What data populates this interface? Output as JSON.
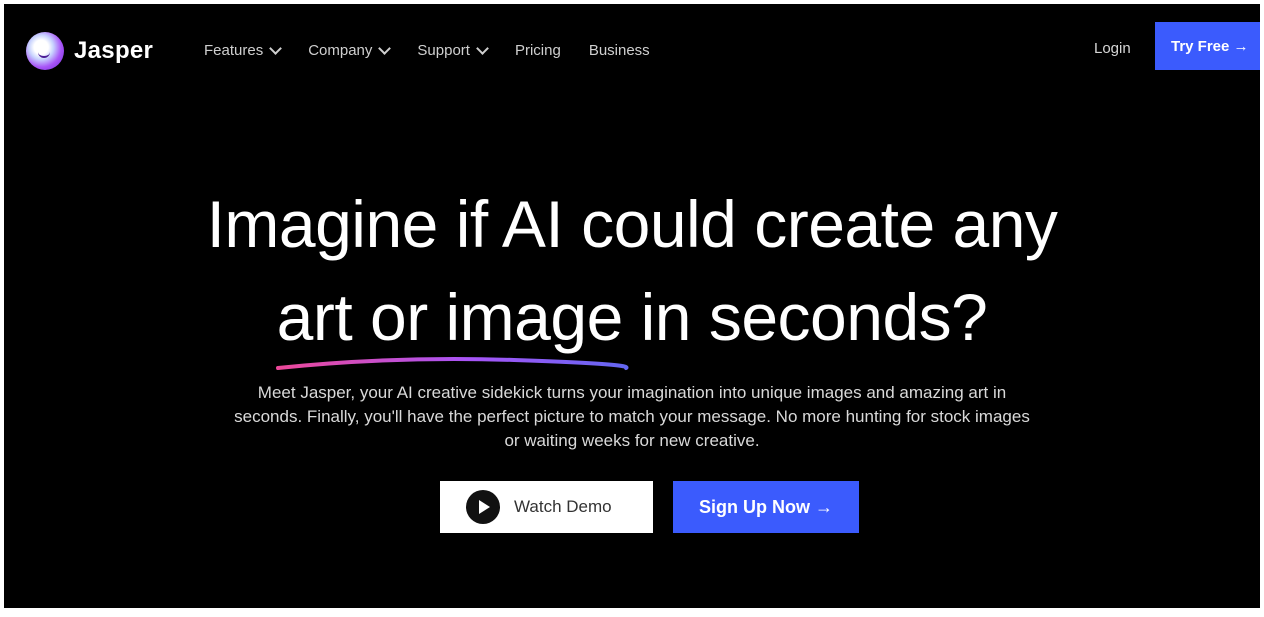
{
  "nav": {
    "logo_text": "Jasper",
    "items": [
      {
        "label": "Features",
        "has_dropdown": true
      },
      {
        "label": "Company",
        "has_dropdown": true
      },
      {
        "label": "Support",
        "has_dropdown": true
      },
      {
        "label": "Pricing",
        "has_dropdown": false
      },
      {
        "label": "Business",
        "has_dropdown": false
      }
    ],
    "login_label": "Login",
    "try_free_label": "Try Free →"
  },
  "hero": {
    "headline_line1": "Imagine if AI could create any",
    "headline_line2": "art or image in seconds?",
    "subtext": "Meet Jasper, your AI creative sidekick turns your imagination into unique images and amazing art in seconds. Finally, you'll have the perfect picture to match your message. No more hunting for stock images or waiting weeks for new creative.",
    "watch_demo_label": "Watch Demo",
    "signup_label": "Sign Up Now →"
  },
  "colors": {
    "background": "#000000",
    "primary_button": "#3b5bfd",
    "underline_start": "#ec4899",
    "underline_end": "#6366f1"
  },
  "icons": {
    "logo": "jasper-logo-icon",
    "dropdown": "chevron-down-icon",
    "play": "play-icon"
  }
}
